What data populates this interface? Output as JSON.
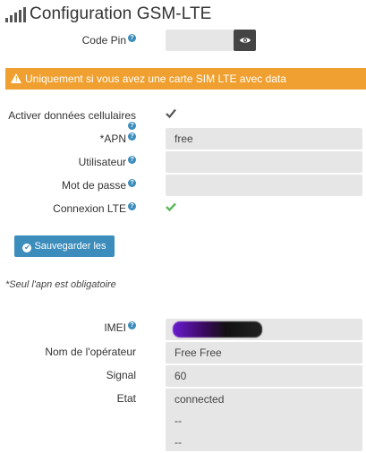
{
  "header": {
    "title": "Configuration GSM-LTE",
    "icon": "signal-bars-icon"
  },
  "code_pin": {
    "label": "Code Pin",
    "value": "",
    "reveal_icon": "eye-icon"
  },
  "warning": {
    "text": "Uniquement si vous avez une carte SIM LTE avec data",
    "color": "#f0a030"
  },
  "cellular": {
    "label": "Activer données cellulaires",
    "checked": true
  },
  "apn": {
    "label": "*APN",
    "value": "free"
  },
  "user": {
    "label": "Utilisateur",
    "value": ""
  },
  "password": {
    "label": "Mot de passe",
    "value": ""
  },
  "lte": {
    "label": "Connexion LTE",
    "status_icon": "check-icon",
    "status_color": "#5cb85c"
  },
  "save_button": {
    "label": "Sauvegarder les APN",
    "color": "#3c8dbc"
  },
  "note": "*Seul l'apn est obligatoire",
  "imei": {
    "label": "IMEI",
    "value": ""
  },
  "operator": {
    "label": "Nom de l'opérateur",
    "value": "Free Free"
  },
  "signal": {
    "label": "Signal",
    "value": "60"
  },
  "state": {
    "label": "Etat",
    "lines": [
      "connected",
      "--",
      "--"
    ]
  }
}
